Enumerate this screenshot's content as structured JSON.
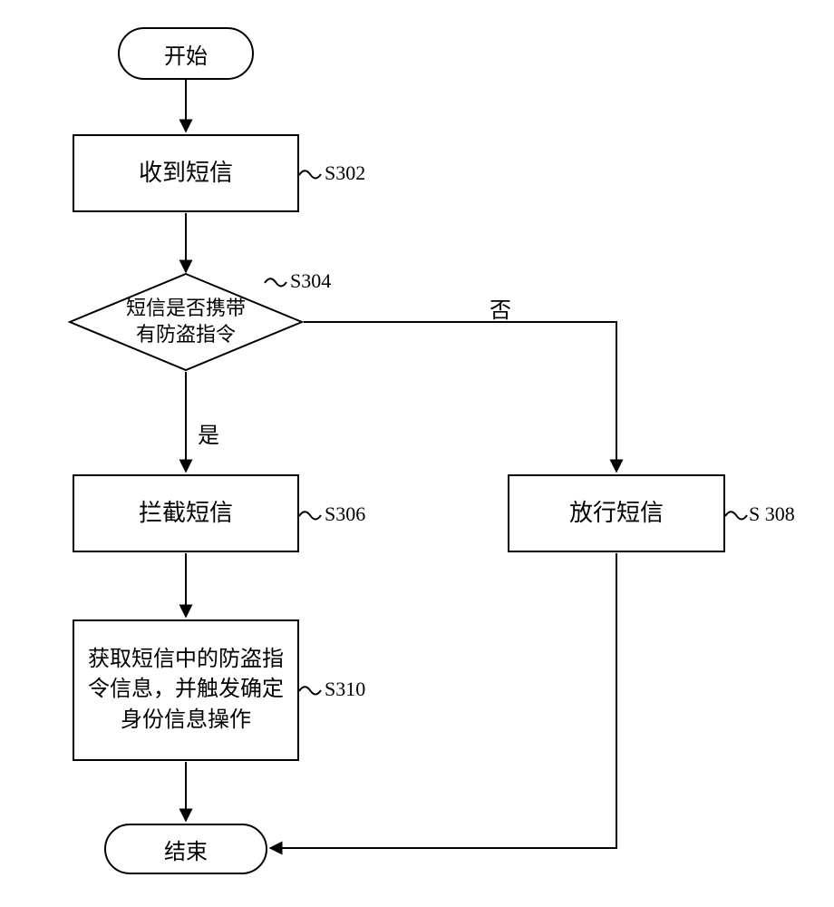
{
  "terminator": {
    "start": "开始",
    "end": "结束"
  },
  "process": {
    "s302": "收到短信",
    "s306": "拦截短信",
    "s308": "放行短信",
    "s310": "获取短信中的防盗指令信息，并触发确定身份信息操作"
  },
  "decision": {
    "s304_line1": "短信是否携带",
    "s304_line2": "有防盗指令"
  },
  "branch": {
    "yes": "是",
    "no": "否"
  },
  "stepno": {
    "s302": "S302",
    "s304": "S304",
    "s306": "S306",
    "s308": "S 308",
    "s310": "S310"
  }
}
